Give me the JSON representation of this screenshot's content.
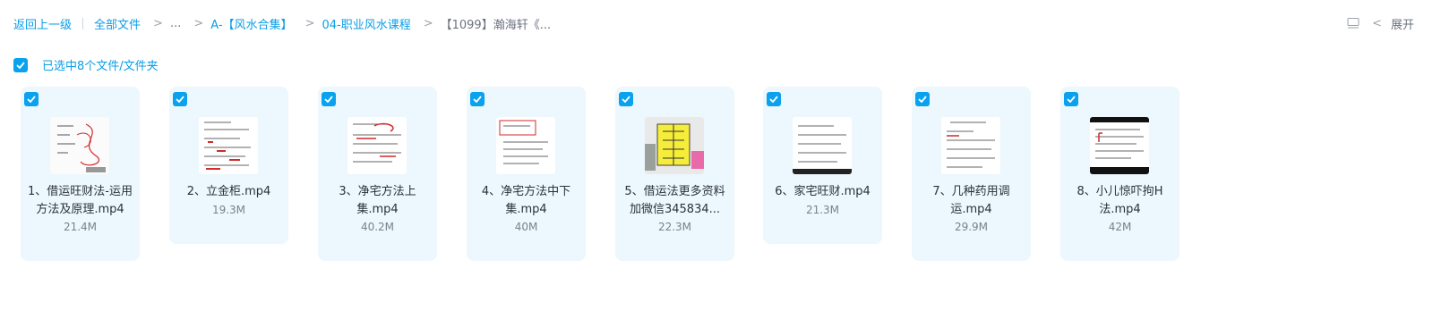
{
  "breadcrumb": {
    "back": "返回上一级",
    "root": "全部文件",
    "ellipsis": "...",
    "level1": "A-【风水合集】",
    "level2": "04-职业风水课程",
    "current": "【1099】瀚海轩《..."
  },
  "toolbar": {
    "expand_label": "展开",
    "list_icon": "list-view-icon",
    "chevron_icon": "chevron-left-icon"
  },
  "selection": {
    "text": "已选中8个文件/文件夹"
  },
  "accent_color": "#0aa1ee",
  "files": [
    {
      "name": "1、借运旺财法-运用方法及原理.mp4",
      "size": "21.4M",
      "thumb": "handwriting"
    },
    {
      "name": "2、立金柜.mp4",
      "size": "19.3M",
      "thumb": "text-red"
    },
    {
      "name": "3、净宅方法上集.mp4",
      "size": "40.2M",
      "thumb": "text-red"
    },
    {
      "name": "4、净宅方法中下集.mp4",
      "size": "40M",
      "thumb": "text-box"
    },
    {
      "name": "5、借运法更多资料加微信345834...",
      "size": "22.3M",
      "thumb": "diagram"
    },
    {
      "name": "6、家宅旺财.mp4",
      "size": "21.3M",
      "thumb": "text"
    },
    {
      "name": "7、几种药用调运.mp4",
      "size": "29.9M",
      "thumb": "text"
    },
    {
      "name": "8、小儿惊吓拘H法.mp4",
      "size": "42M",
      "thumb": "text-dark"
    }
  ]
}
